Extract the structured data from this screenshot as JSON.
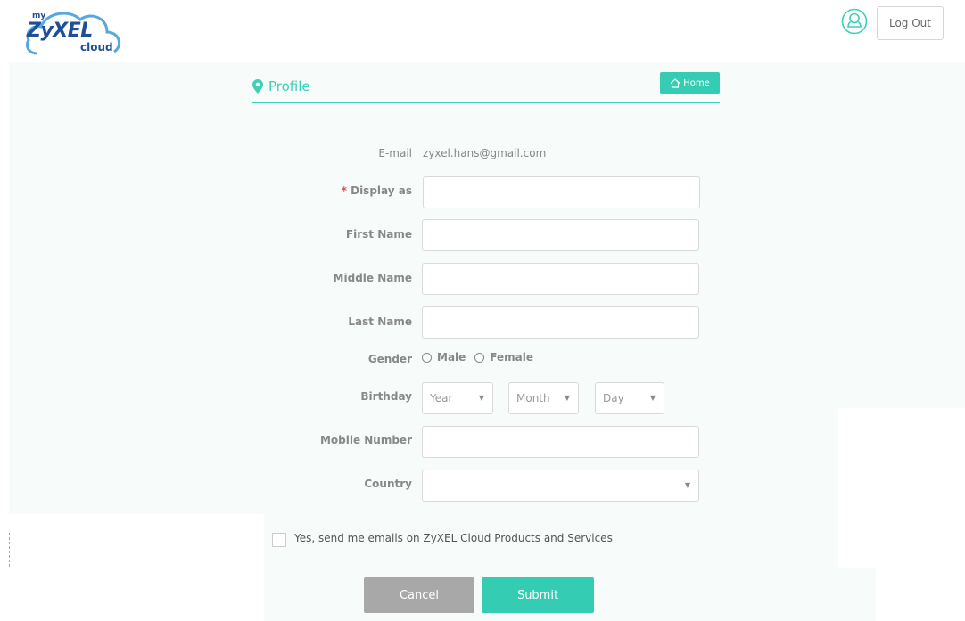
{
  "logo": {
    "my": "my",
    "brand": "ZyXEL",
    "cloud": "cloud",
    "primary_color": "#1f4f97"
  },
  "header": {
    "user_icon": "user-outline-icon",
    "logout_label": "Log Out"
  },
  "profile": {
    "title": "Profile",
    "pin_icon": "location-pin-icon",
    "home_label": "Home",
    "home_icon": "home-icon",
    "accent": "#3fd0b9"
  },
  "form": {
    "email": {
      "label": "E-mail",
      "value": "zyxel.hans@gmail.com"
    },
    "display_as": {
      "required_mark": "*",
      "label": "Display as",
      "value": ""
    },
    "first_name": {
      "label": "First Name",
      "value": ""
    },
    "middle_name": {
      "label": "Middle Name",
      "value": ""
    },
    "last_name": {
      "label": "Last Name",
      "value": ""
    },
    "gender": {
      "label": "Gender",
      "options": [
        "Male",
        "Female"
      ]
    },
    "birthday": {
      "label": "Birthday",
      "year": "Year",
      "month": "Month",
      "day": "Day"
    },
    "mobile": {
      "label": "Mobile Number",
      "value": ""
    },
    "country": {
      "label": "Country",
      "value": ""
    },
    "newsletter": {
      "label": "Yes, send me emails on ZyXEL Cloud Products and Services",
      "checked": false
    }
  },
  "actions": {
    "cancel_label": "Cancel",
    "submit_label": "Submit",
    "submit_color": "#34cdb4",
    "cancel_color": "#a8a8a8"
  }
}
